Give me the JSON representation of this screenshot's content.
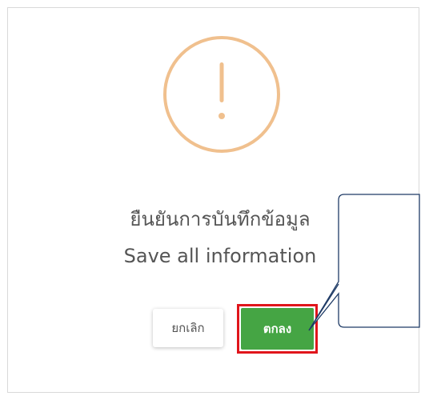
{
  "dialog": {
    "title": "ยืนยันการบันทึกข้อมูล",
    "subtitle": "Save all information",
    "icon": "warning-exclamation-icon",
    "icon_color": "#f0c08e"
  },
  "buttons": {
    "cancel_label": "ยกเลิก",
    "ok_label": "ตกลง",
    "ok_color": "#45a544",
    "highlight_color": "#e0151b"
  },
  "annotation": {
    "callout_text": ""
  }
}
